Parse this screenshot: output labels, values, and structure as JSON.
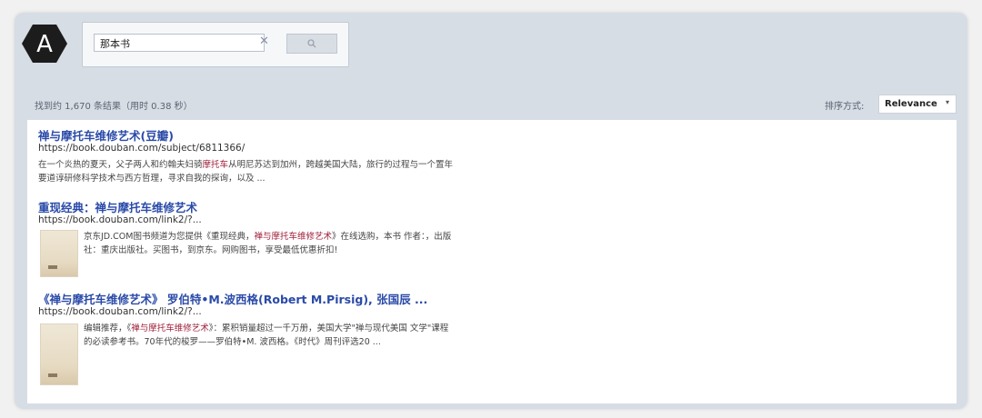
{
  "search": {
    "query": "那本书",
    "clear_symbol": "✕"
  },
  "logo": {
    "letter": "A"
  },
  "stats": {
    "text": "找到约 1,670 条结果（用时 0.38 秒）"
  },
  "sort": {
    "label": "排序方式:",
    "value": "Relevance",
    "caret": "▾"
  },
  "results": [
    {
      "title": "禅与摩托车维修艺术(豆瓣)",
      "url": "https://book.douban.com/subject/6811366/",
      "snippet_before": "在一个炎热的夏天，父子两人和约翰夫妇骑",
      "snippet_highlight": "摩托车",
      "snippet_after": "从明尼苏达到加州，跨越美国大陆，旅行的过程与一个置年要道谆研修科学技术与西方哲理，寻求自我的探询，以及 ..."
    },
    {
      "title": "重现经典：禅与摩托车维修艺术",
      "url": "https://book.douban.com/link2/?...",
      "snippet_before": "京东JD.COM图书频道为您提供《重现经典，",
      "snippet_highlight": "禅与摩托车维修艺术",
      "snippet_after": "》在线选购，本书 作者：，出版社：重庆出版社。买图书，到京东。网购图书，享受最低优惠折扣!"
    },
    {
      "title": "《禅与摩托车维修艺术》 罗伯特•M.波西格(Robert M.Pirsig), 张国辰 ...",
      "url": "https://book.douban.com/link2/?...",
      "snippet_before": "编辑推荐，《",
      "snippet_highlight": "禅与摩托车维修艺术",
      "snippet_after": "》：累积销量超过一千万册，美国大学\"禅与现代美国 文学\"课程的必读参考书。70年代的梭罗——罗伯特•M. 波西格。《时代》周刊评选20 ..."
    }
  ],
  "colors": {
    "frame": "#d7dde5",
    "title_link": "#2a4aa8",
    "highlight": "#a0213b"
  }
}
